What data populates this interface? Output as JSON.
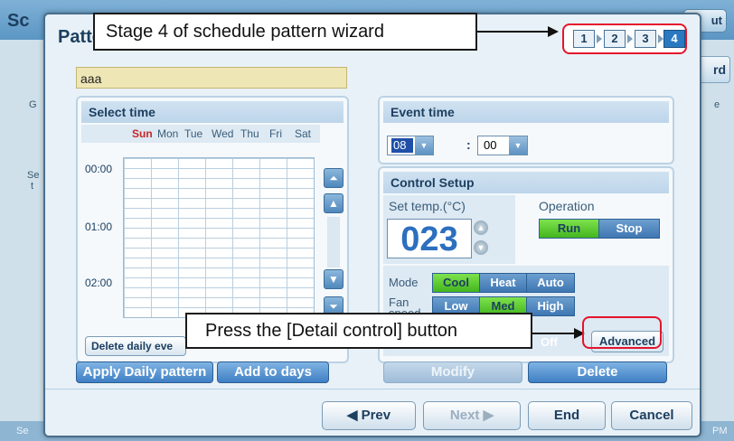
{
  "background": {
    "title_fragment": "Sc",
    "right_button_fragment": "ut",
    "right_tab_fragment": "rd",
    "left_fragments": [
      "G",
      "Se",
      "t"
    ],
    "right_fragment": "e",
    "status_left": "Se",
    "status_right": "PM"
  },
  "dialog": {
    "title": "Patte",
    "steps": [
      "1",
      "2",
      "3",
      "4"
    ],
    "active_step": "4",
    "pattern_name": "aaa"
  },
  "select_time": {
    "header": "Select time",
    "days": [
      "Sun",
      "Mon",
      "Tue",
      "Wed",
      "Thu",
      "Fri",
      "Sat"
    ],
    "hours": [
      "00:00",
      "01:00",
      "02:00"
    ],
    "delete_daily_label": "Delete daily eve"
  },
  "left_buttons": {
    "apply_daily": "Apply Daily pattern",
    "add_to_days": "Add to days"
  },
  "event_time": {
    "header": "Event  time",
    "hour": "08",
    "minute": "00",
    "separator": ":"
  },
  "control_setup": {
    "header": "Control Setup",
    "set_temp_label": "Set temp.(°C)",
    "temperature": "023",
    "operation_label": "Operation",
    "operation_options": [
      "Run",
      "Stop"
    ],
    "operation_selected": "Run",
    "mode_label": "Mode",
    "mode_options": [
      "Cool",
      "Heat",
      "Auto"
    ],
    "mode_selected": "Cool",
    "fan_label_1": "Fan",
    "fan_label_2": "speed",
    "fan_options": [
      "Low",
      "Med",
      "High"
    ],
    "fan_selected": "Med",
    "off_fragment": "Off",
    "advanced_label": "Advanced"
  },
  "right_buttons": {
    "modify": "Modify",
    "delete": "Delete"
  },
  "nav": {
    "prev": "◀ Prev",
    "next": "Next ▶",
    "end": "End",
    "cancel": "Cancel"
  },
  "annotations": {
    "top": "Stage 4 of schedule pattern wizard",
    "bottom": "Press the [Detail control] button",
    "highlight_color": "#e4152c"
  }
}
